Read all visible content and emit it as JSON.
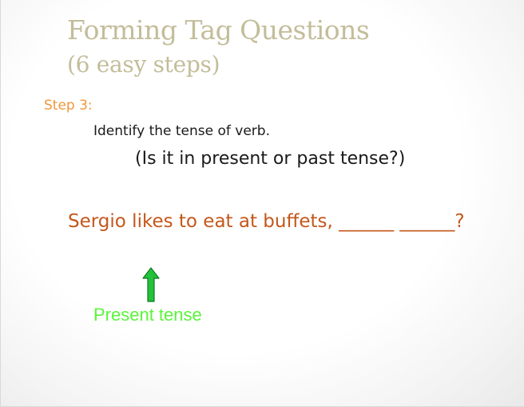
{
  "slide": {
    "title": "Forming Tag Questions",
    "subtitle": "(6 easy steps)",
    "step_label": "Step 3:",
    "instruction": "Identify the tense of verb.",
    "question": "(Is it in present or past tense?)",
    "sentence": "Sergio likes to eat at buffets, ______ ______?",
    "arrow_icon": "up-arrow-icon",
    "annotation": "Present tense",
    "colors": {
      "title": "#c3bd9a",
      "step": "#f0963c",
      "sentence": "#c4571b",
      "arrow_fill": "#22c23a",
      "annotation": "#5af53a"
    }
  }
}
